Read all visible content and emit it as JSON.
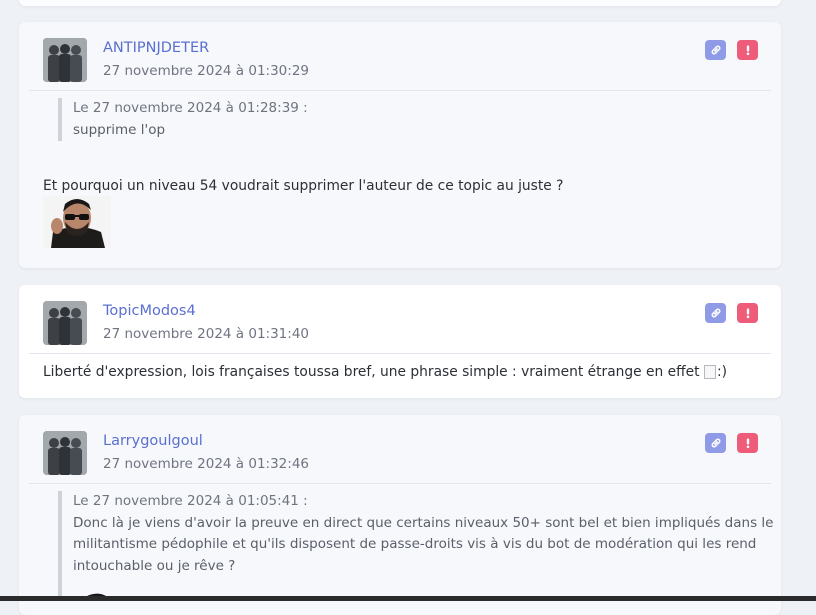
{
  "posts": [
    {
      "author": "ANTIPNJDETER",
      "date": "27 novembre 2024 à 01:30:29",
      "quote": {
        "header": "Le 27 novembre 2024 à 01:28:39 :",
        "body": "supprime l'op"
      },
      "text": "Et pourquoi un niveau 54 voudrait supprimer l'auteur de ce topic au juste ?",
      "sticker": "man-with-sunglasses-sticker"
    },
    {
      "author": "TopicModos4",
      "date": "27 novembre 2024 à 01:31:40",
      "text": "Liberté d'expression, lois françaises toussa bref, une phrase simple : vraiment étrange en effet",
      "smiley_alt": ":)"
    },
    {
      "author": "Larrygoulgoul",
      "date": "27 novembre 2024 à 01:32:46",
      "quote": {
        "header": "Le 27 novembre 2024 à 01:05:41 :",
        "lines": [
          "Donc là je viens d'avoir la preuve en direct que certains niveaux 50+ sont bel et bien impliqués dans le",
          "militantisme pédophile et qu'ils disposent de passe-droits vis à vis du bot de modération qui les rend",
          "intouchable ou je rêve ?"
        ]
      }
    }
  ],
  "icons": {
    "link": "link-icon",
    "report": "exclamation-icon"
  },
  "colors": {
    "author": "#5b6fd1",
    "link_button": "#8f9be6",
    "report_button": "#ee5c7a"
  }
}
